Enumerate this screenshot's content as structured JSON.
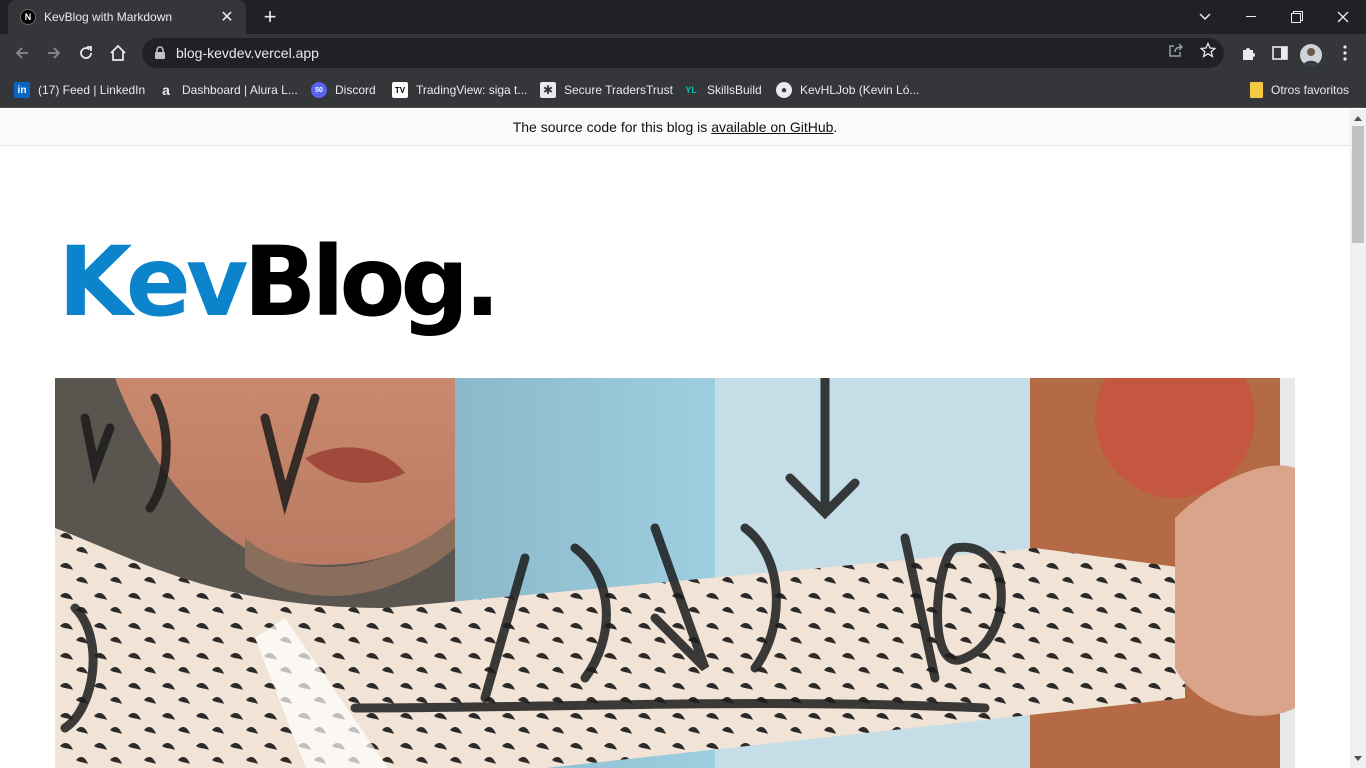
{
  "browser": {
    "tab_title": "KevBlog with Markdown",
    "favicon_letter": "N",
    "url": "blog-kevdev.vercel.app",
    "bookmarks": [
      {
        "label": "(17) Feed | LinkedIn",
        "icon": "linkedin-icon",
        "icon_text": "in",
        "color": "#0a66c2"
      },
      {
        "label": "Dashboard | Alura L...",
        "icon": "alura-icon",
        "icon_text": "a",
        "color": "#35363a"
      },
      {
        "label": "Discord",
        "icon": "discord-icon",
        "icon_text": "50",
        "color": "#5865f2"
      },
      {
        "label": "TradingView: siga t...",
        "icon": "tradingview-icon",
        "icon_text": "TV",
        "color": "#000000"
      },
      {
        "label": "Secure TradersTrust",
        "icon": "traderstrust-icon",
        "icon_text": "✱",
        "color": "#e8eaed"
      },
      {
        "label": "SkillsBuild",
        "icon": "skillsbuild-icon",
        "icon_text": "YL",
        "color": "#35363a"
      },
      {
        "label": "KevHLJob (Kevin Ló...",
        "icon": "github-icon",
        "icon_text": "●",
        "color": "#35363a"
      }
    ],
    "other_bookmarks": "Otros favoritos"
  },
  "page": {
    "banner_prefix": "The source code for this blog is",
    "banner_link": "available on GitHub",
    "banner_suffix": ".",
    "logo_part1": "Kev",
    "logo_part2": "Blog."
  },
  "colors": {
    "accent": "#0b84cc",
    "chrome_dark": "#202124",
    "chrome": "#35363a"
  }
}
